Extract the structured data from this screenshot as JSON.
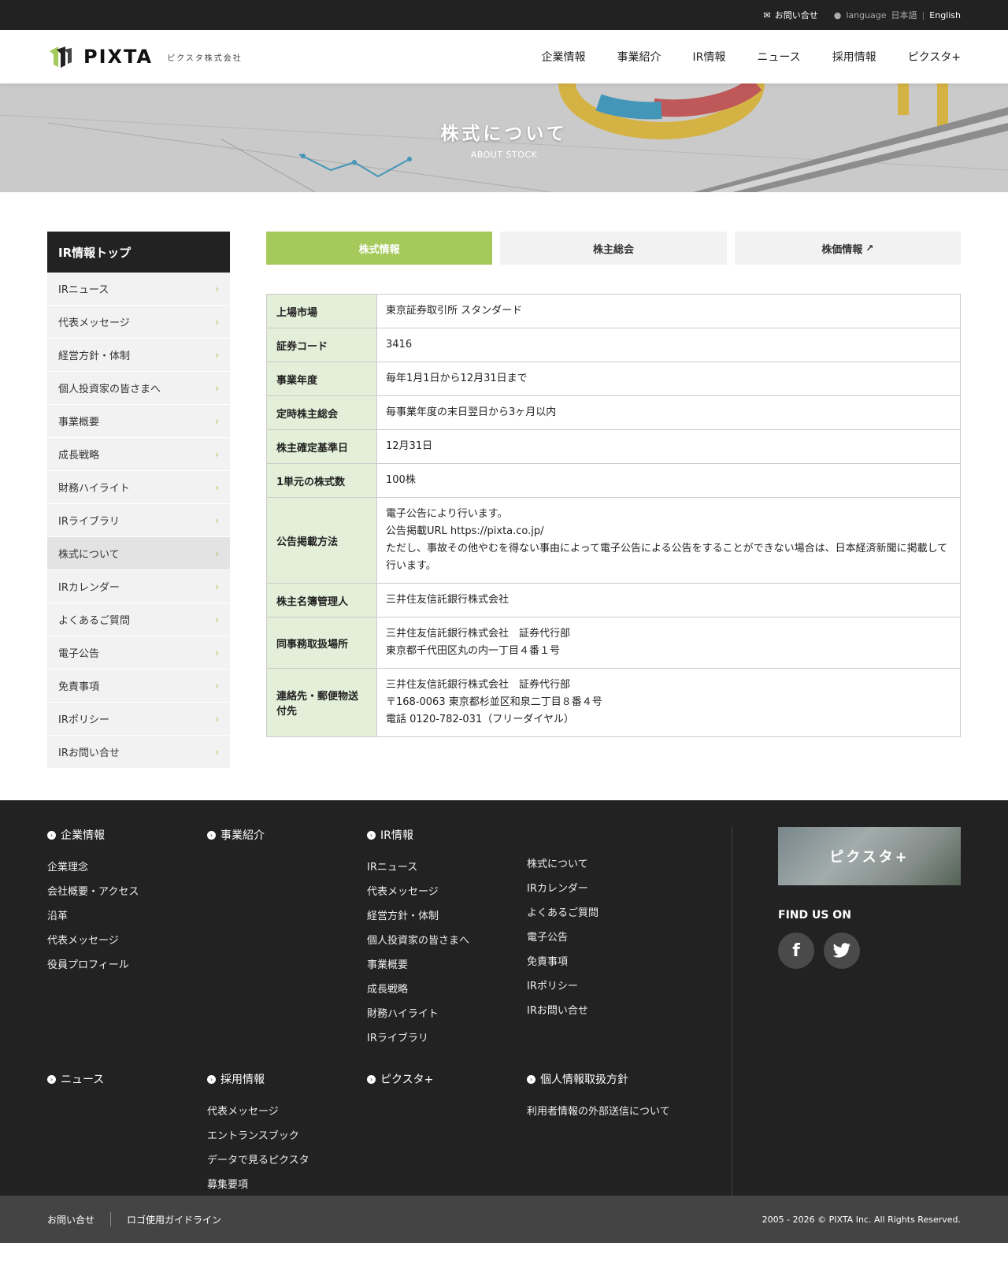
{
  "util": {
    "contact": "お問い合せ",
    "language_label": "language",
    "lang_ja": "日本語",
    "lang_separator": "|",
    "lang_en": "English"
  },
  "header": {
    "logo": "PIXTA",
    "company": "ピクスタ株式会社",
    "nav": [
      "企業情報",
      "事業紹介",
      "IR情報",
      "ニュース",
      "採用情報",
      "ピクスタ+"
    ]
  },
  "hero": {
    "title": "株式について",
    "subtitle": "ABOUT STOCK"
  },
  "sidebar": {
    "title": "IR情報トップ",
    "items": [
      {
        "label": "IRニュース"
      },
      {
        "label": "代表メッセージ"
      },
      {
        "label": "経営方針・体制"
      },
      {
        "label": "個人投資家の皆さまへ"
      },
      {
        "label": "事業概要"
      },
      {
        "label": "成長戦略"
      },
      {
        "label": "財務ハイライト"
      },
      {
        "label": "IRライブラリ"
      },
      {
        "label": "株式について"
      },
      {
        "label": "IRカレンダー"
      },
      {
        "label": "よくあるご質問"
      },
      {
        "label": "電子公告"
      },
      {
        "label": "免責事項"
      },
      {
        "label": "IRポリシー"
      },
      {
        "label": "IRお問い合せ"
      }
    ],
    "active_index": 8,
    "chevron": "›"
  },
  "tabs": [
    {
      "label": "株式情報",
      "active": true
    },
    {
      "label": "株主総会",
      "active": false
    },
    {
      "label": "株価情報",
      "active": false,
      "external": true
    }
  ],
  "table": [
    {
      "label": "上場市場",
      "lines": [
        "東京証券取引所 スタンダード"
      ]
    },
    {
      "label": "証券コード",
      "lines": [
        "3416"
      ]
    },
    {
      "label": "事業年度",
      "lines": [
        "毎年1月1日から12月31日まで"
      ]
    },
    {
      "label": "定時株主総会",
      "lines": [
        "毎事業年度の末日翌日から3ヶ月以内"
      ]
    },
    {
      "label": "株主確定基準日",
      "lines": [
        "12月31日"
      ]
    },
    {
      "label": "1単元の株式数",
      "lines": [
        "100株"
      ]
    },
    {
      "label": "公告掲載方法",
      "lines": [
        "電子公告により行います。",
        "公告掲載URL https://pixta.co.jp/",
        "ただし、事故その他やむを得ない事由によって電子公告による公告をすることができない場合は、日本経済新聞に掲載して行います。"
      ]
    },
    {
      "label": "株主名簿管理人",
      "lines": [
        "三井住友信託銀行株式会社"
      ]
    },
    {
      "label": "同事務取扱場所",
      "lines": [
        "三井住友信託銀行株式会社　証券代行部",
        "東京都千代田区丸の内一丁目４番１号"
      ]
    },
    {
      "label": "連絡先・郵便物送付先",
      "lines": [
        "三井住友信託銀行株式会社　証券代行部",
        "〒168-0063 東京都杉並区和泉二丁目８番４号",
        "電話 0120-782-031（フリーダイヤル）"
      ]
    }
  ],
  "footer": {
    "row1": [
      {
        "head": "企業情報",
        "links": [
          "企業理念",
          "会社概要・アクセス",
          "沿革",
          "代表メッセージ",
          "役員プロフィール"
        ]
      },
      {
        "head": "事業紹介",
        "links": []
      },
      {
        "head": "IR情報",
        "links": [
          "IRニュース",
          "代表メッセージ",
          "経営方針・体制",
          "個人投資家の皆さまへ",
          "事業概要",
          "成長戦略",
          "財務ハイライト",
          "IRライブラリ"
        ]
      },
      {
        "head": "",
        "links": [
          "株式について",
          "IRカレンダー",
          "よくあるご質問",
          "電子公告",
          "免責事項",
          "IRポリシー",
          "IRお問い合せ"
        ]
      }
    ],
    "row2": [
      {
        "head": "ニュース",
        "links": []
      },
      {
        "head": "採用情報",
        "links": [
          "代表メッセージ",
          "エントランスブック",
          "データで見るピクスタ",
          "募集要項"
        ]
      },
      {
        "head": "ピクスタ+",
        "links": []
      },
      {
        "head": "個人情報取扱方針",
        "links": [
          "利用者情報の外部送信について"
        ]
      }
    ],
    "banner": "ピクスタ+",
    "find_us": "FIND US ON",
    "social": [
      "facebook-icon",
      "twitter-icon"
    ]
  },
  "bottom": {
    "links": [
      "お問い合せ",
      "ロゴ使用ガイドライン"
    ],
    "copyright": "2005 - 2026 © PIXTA Inc. All Rights Reserved."
  },
  "colors": {
    "accent": "#a5c95a",
    "dark": "#222222",
    "th_bg": "#e3efd9"
  }
}
